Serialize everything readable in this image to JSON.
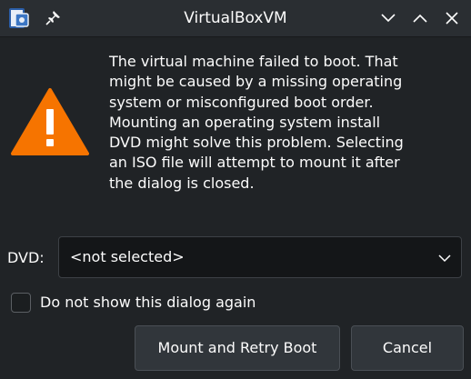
{
  "window": {
    "title": "VirtualBoxVM",
    "app_icon": "virtualbox-icon",
    "pin_icon": "pin-icon",
    "controls": [
      "minimize-icon",
      "maximize-icon",
      "close-icon"
    ]
  },
  "dialog": {
    "icon": "warning-icon",
    "icon_color": "#f67400",
    "message": "The virtual machine failed to boot. That\nmight be caused by a missing operating\nsystem or misconfigured boot order.\nMounting an operating system install\nDVD might solve this problem. Selecting\nan ISO file will attempt to mount it after\nthe dialog is closed.",
    "dvd": {
      "label": "DVD:",
      "selected": "<not selected>"
    },
    "checkbox": {
      "label": "Do not show this dialog again",
      "checked": false
    },
    "buttons": {
      "mount": "Mount and Retry Boot",
      "cancel": "Cancel"
    }
  }
}
